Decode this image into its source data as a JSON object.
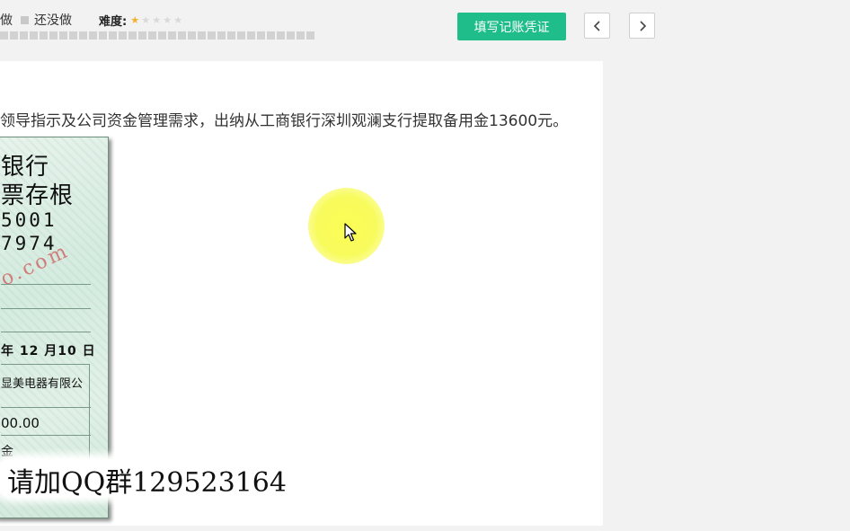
{
  "toolbar": {
    "legend_done": "做",
    "legend_undone": "还没做",
    "difficulty_label": "难度:",
    "difficulty_rating": 1,
    "difficulty_max": 5,
    "progress_cells": 32,
    "voucher_button": "填写记账凭证",
    "prev_icon": "chevron-left-icon",
    "next_icon": "chevron-right-icon"
  },
  "question": {
    "text": "领导指示及公司资金管理需求，出纳从工商银行深圳观澜支行提取备用金13600元。"
  },
  "cheque": {
    "bank_line": "银行",
    "title_line": "票存根",
    "number_line1": "5001",
    "number_line2": "7974",
    "watermark": "o.com",
    "date": "年 12 月10 日",
    "payee": "显美电器有限公",
    "amount": "00.00",
    "use": "金"
  },
  "overlay": {
    "qq_text": "请加QQ群129523164"
  },
  "colors": {
    "accent": "#1fbd8a",
    "star_on": "#f1b12b",
    "cursor_highlight": "#f8fb5c"
  }
}
